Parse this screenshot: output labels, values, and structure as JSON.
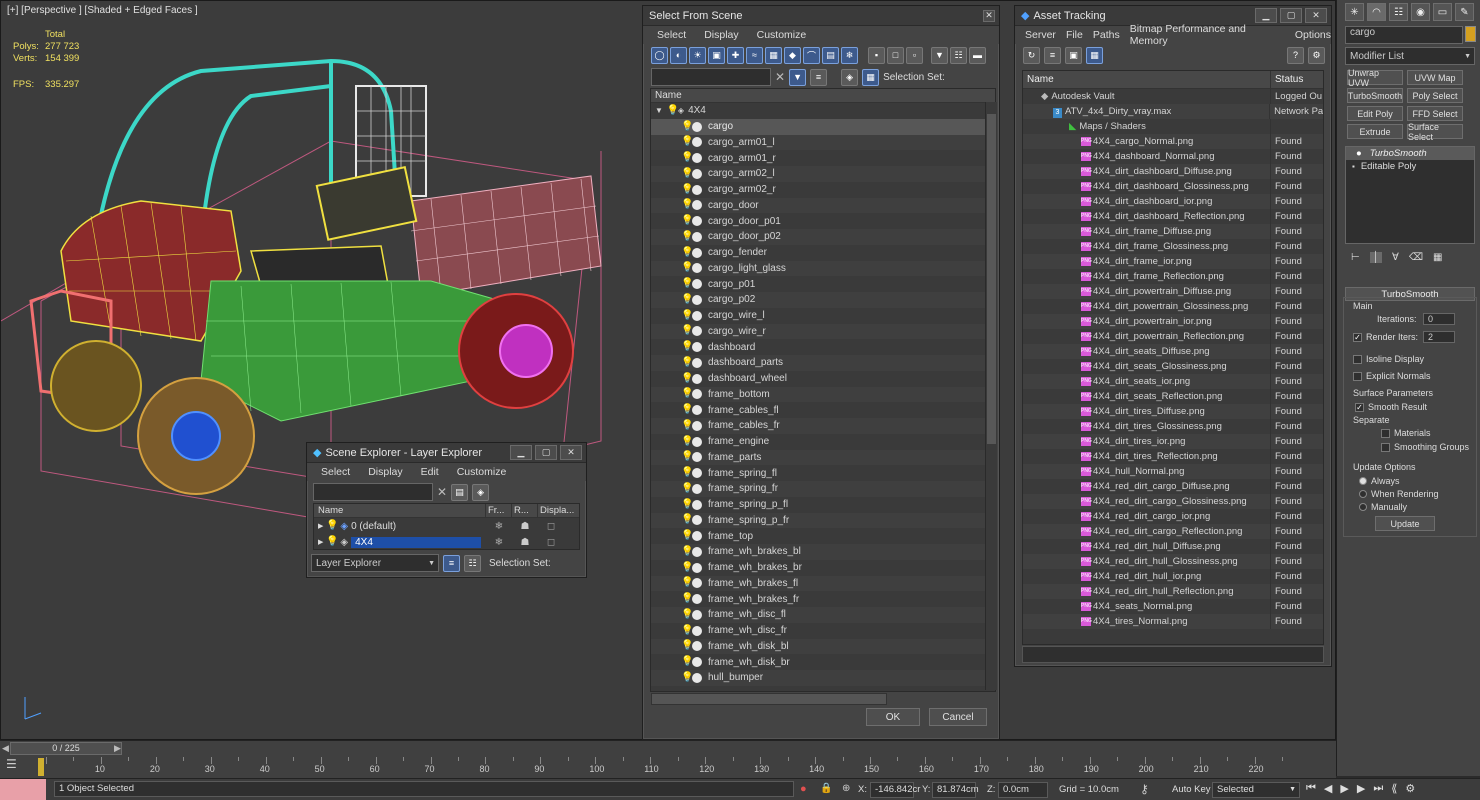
{
  "viewport": {
    "label": "[+] [Perspective ] [Shaded + Edged Faces ]",
    "stats": {
      "total_label": "Total",
      "polys_label": "Polys:",
      "polys_value": "277 723",
      "verts_label": "Verts:",
      "verts_value": "154 399",
      "fps_label": "FPS:",
      "fps_value": "335.297"
    }
  },
  "select_from_scene": {
    "title": "Select From Scene",
    "menus": [
      "Select",
      "Display",
      "Customize"
    ],
    "selection_set_label": "Selection Set:",
    "column_name": "Name",
    "root_label": "4X4",
    "items": [
      "cargo",
      "cargo_arm01_l",
      "cargo_arm01_r",
      "cargo_arm02_l",
      "cargo_arm02_r",
      "cargo_door",
      "cargo_door_p01",
      "cargo_door_p02",
      "cargo_fender",
      "cargo_light_glass",
      "cargo_p01",
      "cargo_p02",
      "cargo_wire_l",
      "cargo_wire_r",
      "dashboard",
      "dashboard_parts",
      "dashboard_wheel",
      "frame_bottom",
      "frame_cables_fl",
      "frame_cables_fr",
      "frame_engine",
      "frame_parts",
      "frame_spring_fl",
      "frame_spring_fr",
      "frame_spring_p_fl",
      "frame_spring_p_fr",
      "frame_top",
      "frame_wh_brakes_bl",
      "frame_wh_brakes_br",
      "frame_wh_brakes_fl",
      "frame_wh_brakes_fr",
      "frame_wh_disc_fl",
      "frame_wh_disc_fr",
      "frame_wh_disk_bl",
      "frame_wh_disk_br",
      "hull_bumper"
    ],
    "ok_label": "OK",
    "cancel_label": "Cancel"
  },
  "asset_tracking": {
    "title": "Asset Tracking",
    "menus": [
      "Server",
      "File",
      "Paths",
      "Bitmap Performance and Memory",
      "Options"
    ],
    "col_name": "Name",
    "col_status": "Status",
    "vault": {
      "name": "Autodesk Vault",
      "status": "Logged Ou"
    },
    "file": {
      "name": "ATV_4x4_Dirty_vray.max",
      "status": "Network Pa"
    },
    "maps_label": "Maps / Shaders",
    "maps": [
      "4X4_cargo_Normal.png",
      "4X4_dashboard_Normal.png",
      "4X4_dirt_dashboard_Diffuse.png",
      "4X4_dirt_dashboard_Glossiness.png",
      "4X4_dirt_dashboard_ior.png",
      "4X4_dirt_dashboard_Reflection.png",
      "4X4_dirt_frame_Diffuse.png",
      "4X4_dirt_frame_Glossiness.png",
      "4X4_dirt_frame_ior.png",
      "4X4_dirt_frame_Reflection.png",
      "4X4_dirt_powertrain_Diffuse.png",
      "4X4_dirt_powertrain_Glossiness.png",
      "4X4_dirt_powertrain_ior.png",
      "4X4_dirt_powertrain_Reflection.png",
      "4X4_dirt_seats_Diffuse.png",
      "4X4_dirt_seats_Glossiness.png",
      "4X4_dirt_seats_ior.png",
      "4X4_dirt_seats_Reflection.png",
      "4X4_dirt_tires_Diffuse.png",
      "4X4_dirt_tires_Glossiness.png",
      "4X4_dirt_tires_ior.png",
      "4X4_dirt_tires_Reflection.png",
      "4X4_hull_Normal.png",
      "4X4_red_dirt_cargo_Diffuse.png",
      "4X4_red_dirt_cargo_Glossiness.png",
      "4X4_red_dirt_cargo_ior.png",
      "4X4_red_dirt_cargo_Reflection.png",
      "4X4_red_dirt_hull_Diffuse.png",
      "4X4_red_dirt_hull_Glossiness.png",
      "4X4_red_dirt_hull_ior.png",
      "4X4_red_dirt_hull_Reflection.png",
      "4X4_seats_Normal.png",
      "4X4_tires_Normal.png"
    ],
    "found_label": "Found",
    "png_badge": "PNG"
  },
  "layer_explorer": {
    "title": "Scene Explorer - Layer Explorer",
    "menus": [
      "Select",
      "Display",
      "Edit",
      "Customize"
    ],
    "cols": [
      "Name",
      "Fr...",
      "R...",
      "Displa..."
    ],
    "layers": [
      "0 (default)",
      "4X4"
    ],
    "mode_label": "Layer Explorer",
    "selection_set_label": "Selection Set:"
  },
  "command_panel": {
    "search_value": "cargo",
    "modifier_list": "Modifier List",
    "buttons": [
      "Unwrap UVW",
      "UVW Map",
      "TurboSmooth",
      "Poly Select",
      "Edit Poly",
      "FFD Select",
      "Extrude",
      "Surface Select"
    ],
    "stack": [
      "TurboSmooth",
      "Editable Poly"
    ],
    "rollout_title": "TurboSmooth",
    "main_label": "Main",
    "iterations_label": "Iterations:",
    "iterations_value": "0",
    "render_iters_label": "Render Iters:",
    "render_iters_value": "2",
    "isoline_label": "Isoline Display",
    "explicit_label": "Explicit Normals",
    "surface_label": "Surface Parameters",
    "smooth_result_label": "Smooth Result",
    "separate_label": "Separate",
    "materials_label": "Materials",
    "smoothing_label": "Smoothing Groups",
    "update_options_label": "Update Options",
    "always_label": "Always",
    "when_rendering_label": "When Rendering",
    "manually_label": "Manually",
    "update_button": "Update"
  },
  "timeline": {
    "slider": "0 / 225",
    "ticks": [
      "10",
      "20",
      "30",
      "40",
      "50",
      "60",
      "70",
      "80",
      "90",
      "100",
      "110",
      "120",
      "130",
      "140",
      "150",
      "160",
      "170",
      "180",
      "190",
      "200",
      "210",
      "220"
    ]
  },
  "status_bar": {
    "selection": "1 Object Selected",
    "x_label": "X:",
    "x_value": "-146.842cr",
    "y_label": "Y:",
    "y_value": "81.874cm",
    "z_label": "Z:",
    "z_value": "0.0cm",
    "grid": "Grid = 10.0cm",
    "auto_key": "Auto Key",
    "selected": "Selected"
  },
  "colors": {
    "accent": "#1e4fa8",
    "found_png": "#d85ad8",
    "stats": "#f0e060"
  }
}
